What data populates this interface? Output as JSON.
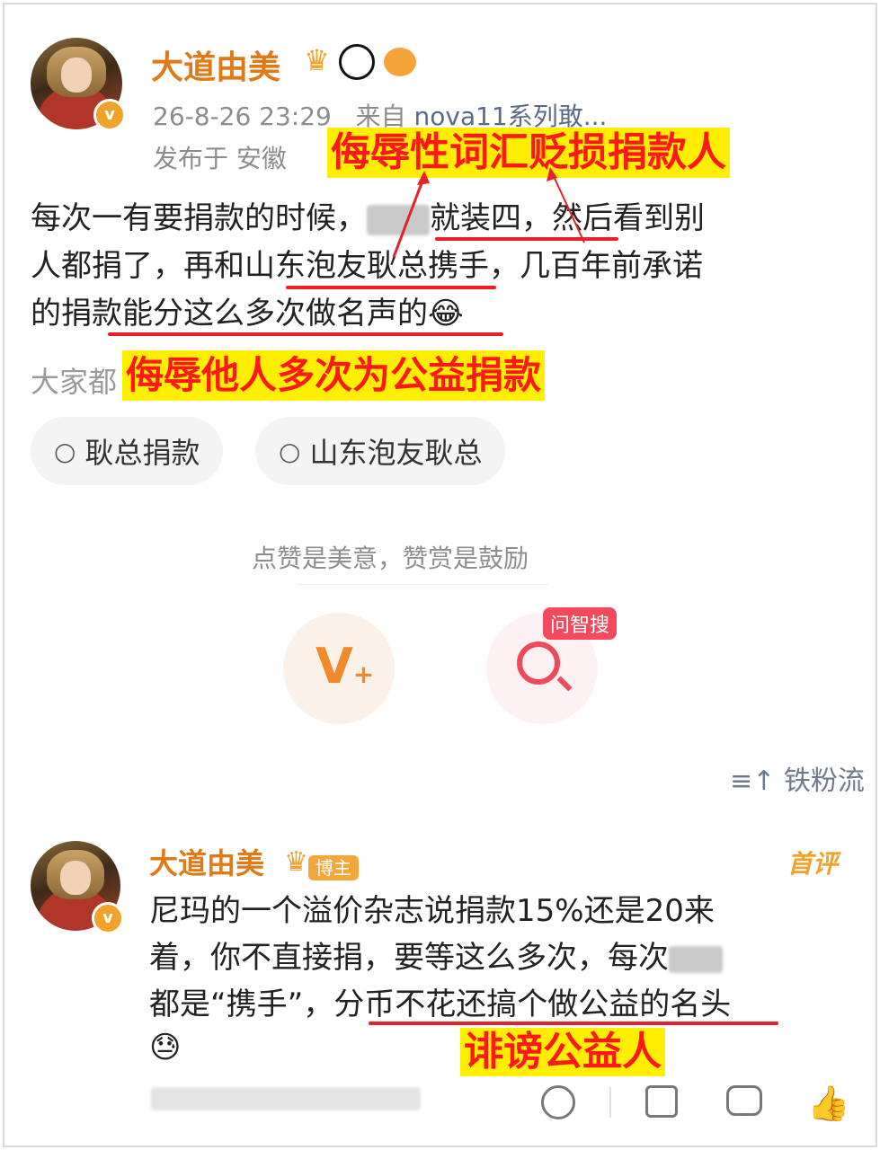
{
  "post": {
    "username": "大道由美",
    "timestamp": "26-8-26 23:29",
    "source_prefix": "来自",
    "source": "nova11系列敢...",
    "location": "发布于 安徽",
    "line1a": "每次一有要捐款的时候，",
    "line1b": "就装四，然后看到别",
    "line2": "人都捐了，再和山东泡友耿总携手，几百年前承诺",
    "line3": "的捐款能分这么多次做名声的",
    "line3_emoji": "😂",
    "faded_text": "大家都"
  },
  "annotations": {
    "top": "侮辱性词汇贬损捐款人",
    "middle": "侮辱他人多次为公益捐款",
    "bottom": "诽谤公益人"
  },
  "topics": [
    {
      "label": "耿总捐款",
      "icon": "search-icon"
    },
    {
      "label": "山东泡友耿总",
      "icon": "search-icon"
    }
  ],
  "reward": {
    "hint": "点赞是美意，赞赏是鼓励",
    "ai_badge": "问智搜"
  },
  "iron_fans": "铁粉流",
  "comment": {
    "username": "大道由美",
    "role_badge": "博主",
    "first_tag": "首评",
    "line1": "尼玛的一个溢价杂志说捐款15%还是20来",
    "line2": "着，你不直接捐，要等这么多次，每次",
    "line3": "都是“携手”，分币不花还搞个做公益的名头",
    "emoji": "😓"
  },
  "colors": {
    "username": "#e07a18",
    "annotation_text": "#ff1818",
    "annotation_bg": "#ffee00",
    "underline": "#e8202a"
  }
}
